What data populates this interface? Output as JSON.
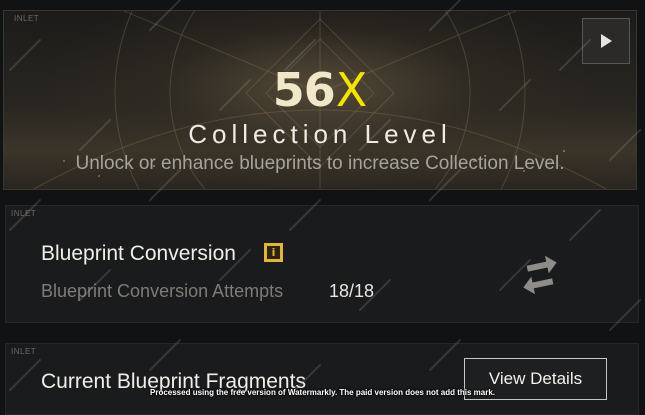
{
  "banner": {
    "inlet": "INLET",
    "level_number": "56",
    "level_mark": "X",
    "title": "Collection Level",
    "subtitle": "Unlock or enhance blueprints to increase Collection Level.",
    "play_icon": "play-triangle-icon"
  },
  "conversion": {
    "inlet": "INLET",
    "title": "Blueprint Conversion",
    "info_icon": "i",
    "attempts_label": "Blueprint Conversion Attempts",
    "attempts_value": "18/18",
    "swap_icon": "swap-arrows-icon"
  },
  "fragments": {
    "inlet": "INLET",
    "title": "Current Blueprint Fragments",
    "details_button": "View Details"
  },
  "watermark_notice": "Processed using the free version of Watermarkly. The paid version does not add this mark.",
  "colors": {
    "accent_gold": "#e2b53a",
    "level_mark_yellow": "#f4e200",
    "background": "#111213",
    "card": "#1a1b1d"
  }
}
